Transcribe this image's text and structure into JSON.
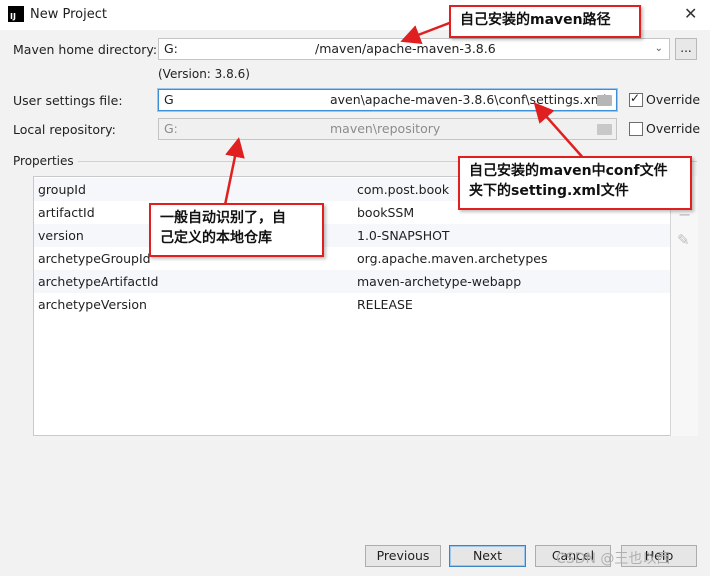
{
  "window": {
    "title": "New Project",
    "close_glyph": "✕"
  },
  "maven_home": {
    "label": "Maven home directory:",
    "value_start": "G:",
    "value_end": "/maven/apache-maven-3.8.6",
    "version": "(Version: 3.8.6)",
    "browse_label": "..."
  },
  "user_settings": {
    "label": "User settings file:",
    "value_start": "G",
    "value_end": "aven\\apache-maven-3.8.6\\conf\\settings.xml",
    "override_label": "Override",
    "override_checked": true
  },
  "local_repo": {
    "label": "Local repository:",
    "value_start": "G:",
    "value_end": "maven\\repository",
    "override_label": "Override",
    "override_checked": false
  },
  "properties": {
    "label": "Properties",
    "rows": [
      {
        "key": "groupId",
        "value": "com.post.book"
      },
      {
        "key": "artifactId",
        "value": "bookSSM"
      },
      {
        "key": "version",
        "value": "1.0-SNAPSHOT"
      },
      {
        "key": "archetypeGroupId",
        "value": "org.apache.maven.archetypes"
      },
      {
        "key": "archetypeArtifactId",
        "value": "maven-archetype-webapp"
      },
      {
        "key": "archetypeVersion",
        "value": "RELEASE"
      }
    ],
    "add_glyph": "+",
    "remove_glyph": "−",
    "edit_glyph": "✎"
  },
  "buttons": {
    "previous": "Previous",
    "next": "Next",
    "cancel": "Cancel",
    "help": "Help"
  },
  "annotations": {
    "maven_path": "自己安装的maven路径",
    "settings_xml_line1": "自己安装的maven中conf文件",
    "settings_xml_line2": "夹下的setting.xml文件",
    "local_repo_line1": "一般自动识别了，自",
    "local_repo_line2": "己定义的本地仓库"
  },
  "watermark": "CSDN @王也以西",
  "colors": {
    "annotation_border": "#e02020",
    "arrow": "#e02020",
    "focus": "#3d8fd6"
  }
}
